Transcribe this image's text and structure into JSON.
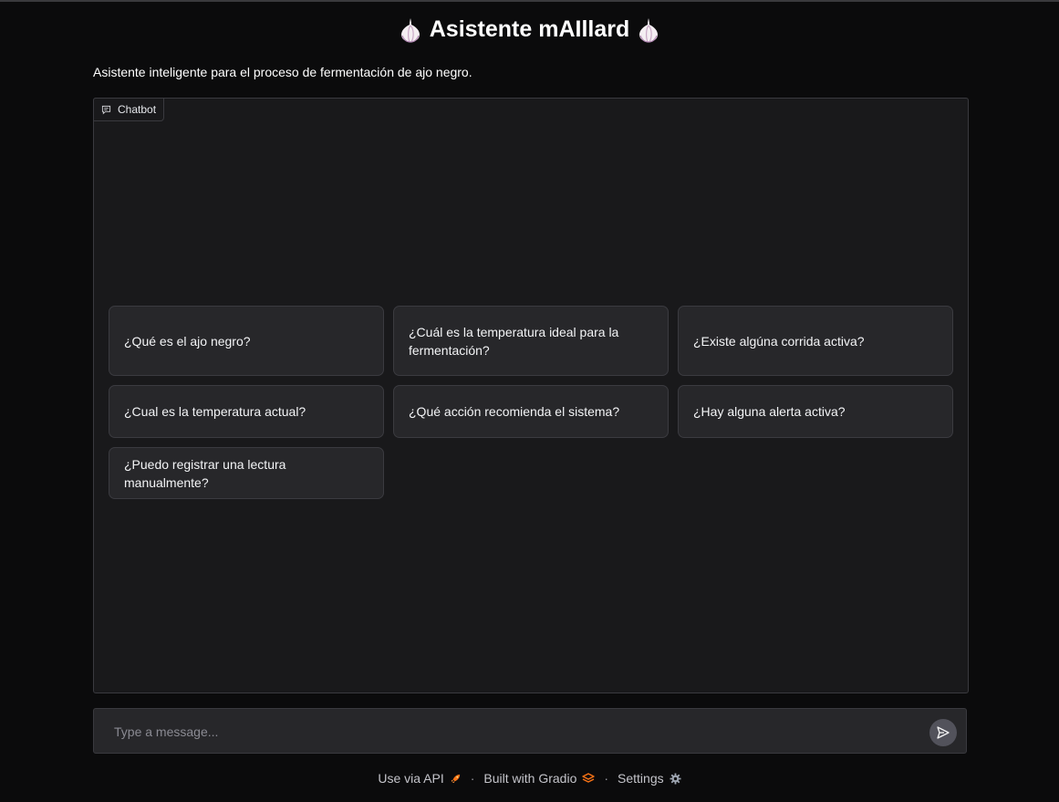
{
  "header": {
    "title": "Asistente mAIllard",
    "icon_left": "garlic-icon",
    "icon_right": "garlic-icon"
  },
  "description": "Asistente inteligente para el proceso de fermentación de ajo negro.",
  "chatbot": {
    "label": "Chatbot",
    "label_icon": "chat-bubble-icon",
    "examples": [
      "¿Qué es el ajo negro?",
      "¿Cuál es la temperatura ideal para la fermentación?",
      "¿Existe algúna corrida activa?",
      "¿Cual es la temperatura actual?",
      "¿Qué acción recomienda el sistema?",
      "¿Hay alguna alerta activa?",
      "¿Puedo registrar una lectura manualmente?"
    ]
  },
  "input": {
    "placeholder": "Type a message...",
    "value": "",
    "send_icon": "send-icon"
  },
  "footer": {
    "api_label": "Use via API",
    "api_icon": "rocket-icon",
    "built_label": "Built with Gradio",
    "built_icon": "gradio-logo-icon",
    "settings_label": "Settings",
    "settings_icon": "gear-icon",
    "separator": "·"
  },
  "colors": {
    "background": "#0b0b0c",
    "panel": "#19191b",
    "example_bg": "#27272a",
    "border": "#3a3a3f",
    "accent": "#f97316"
  }
}
